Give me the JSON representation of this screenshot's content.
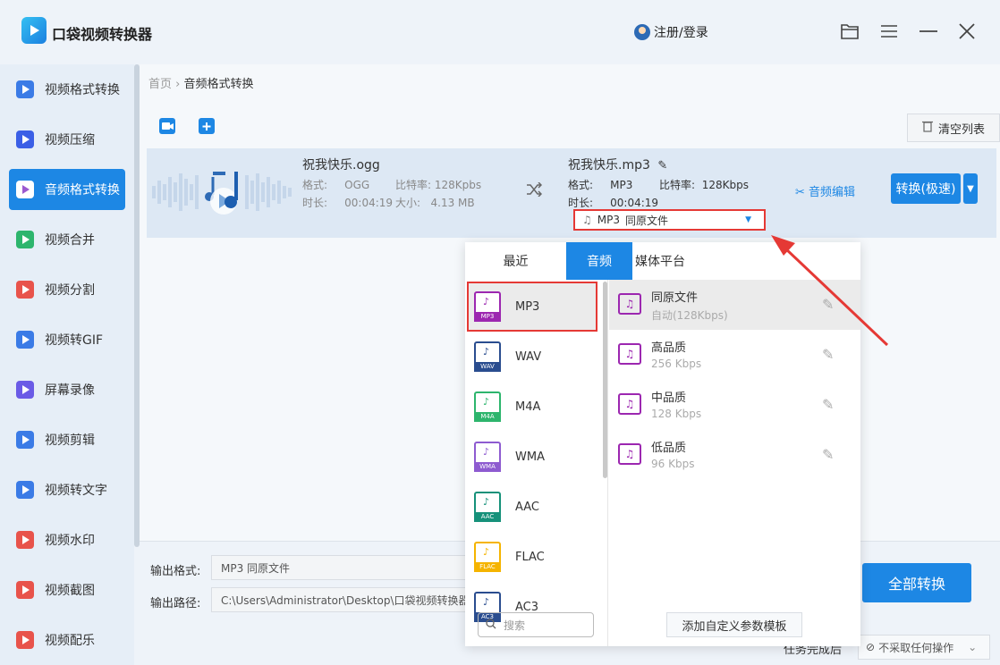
{
  "app": {
    "title": "口袋视频转换器",
    "login": "注册/登录"
  },
  "window_icons": [
    "folder-icon",
    "menu-icon",
    "minimize-icon",
    "close-icon"
  ],
  "sidebar": {
    "items": [
      {
        "label": "视频格式转换",
        "color": "#3b7be6"
      },
      {
        "label": "视频压缩",
        "color": "#3b5fe6"
      },
      {
        "label": "音频格式转换",
        "color": "#9b59d0",
        "active": true
      },
      {
        "label": "视频合并",
        "color": "#2db56d"
      },
      {
        "label": "视频分割",
        "color": "#e8534b"
      },
      {
        "label": "视频转GIF",
        "color": "#3b7be6"
      },
      {
        "label": "屏幕录像",
        "color": "#6a5be6"
      },
      {
        "label": "视频剪辑",
        "color": "#3b7be6"
      },
      {
        "label": "视频转文字",
        "color": "#3b7be6"
      },
      {
        "label": "视频水印",
        "color": "#e8534b"
      },
      {
        "label": "视频截图",
        "color": "#e8534b"
      },
      {
        "label": "视频配乐",
        "color": "#e8534b"
      }
    ]
  },
  "breadcrumb": {
    "home": "首页",
    "sep": "›",
    "current": "音频格式转换"
  },
  "toolbar": {
    "clear_label": "清空列表"
  },
  "file": {
    "source": {
      "name": "祝我快乐.ogg",
      "format_label": "格式:",
      "format": "OGG",
      "bitrate_label": "比特率:",
      "bitrate": "128Kpbs",
      "duration_label": "时长:",
      "duration": "00:04:19",
      "size_label": "大小:",
      "size": "4.13 MB"
    },
    "target": {
      "name": "祝我快乐.mp3",
      "format_label": "格式:",
      "format": "MP3",
      "bitrate_label": "比特率:",
      "bitrate": "128Kbps",
      "duration_label": "时长:",
      "duration": "00:04:19"
    },
    "edit_label": "音频编辑",
    "convert_label": "转换(极速)",
    "format_select": {
      "format": "MP3",
      "quality": "同原文件"
    }
  },
  "bottom": {
    "output_format_label": "输出格式:",
    "output_format_value": "MP3  同原文件",
    "output_path_label": "输出路径:",
    "output_path_value": "C:\\Users\\Administrator\\Desktop\\口袋视频转换器",
    "convert_all_label": "全部转换",
    "task_done_label": "任务完成后",
    "task_done_value": "不采取任何操作"
  },
  "popup": {
    "tabs": [
      "最近",
      "音频",
      "媒体平台"
    ],
    "active_tab": "音频",
    "formats": [
      {
        "name": "MP3",
        "color": "#9c27b0",
        "selected": true
      },
      {
        "name": "WAV",
        "color": "#2a4d8f"
      },
      {
        "name": "M4A",
        "color": "#2db56d"
      },
      {
        "name": "WMA",
        "color": "#8e5bd0"
      },
      {
        "name": "AAC",
        "color": "#16917a"
      },
      {
        "name": "FLAC",
        "color": "#f5b400"
      },
      {
        "name": "AC3",
        "color": "#2a4d8f"
      }
    ],
    "qualities": [
      {
        "name": "同原文件",
        "sub": "自动(128Kbps)",
        "selected": true
      },
      {
        "name": "高品质",
        "sub": "256 Kbps"
      },
      {
        "name": "中品质",
        "sub": "128 Kbps"
      },
      {
        "name": "低品质",
        "sub": "96 Kbps"
      }
    ],
    "search_placeholder": "搜索",
    "add_template_label": "添加自定义参数模板"
  },
  "accent_color": "#1d87e4",
  "highlight_color": "#e53935"
}
